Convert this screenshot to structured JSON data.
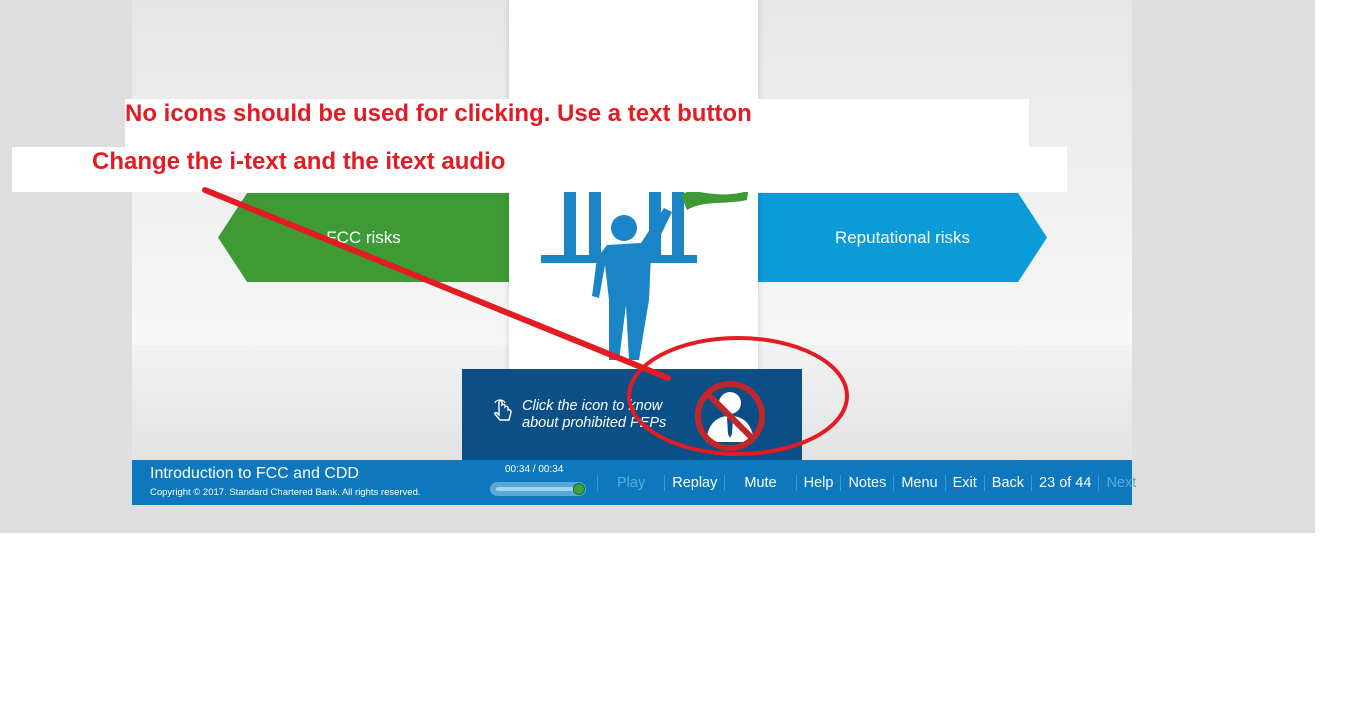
{
  "annotations": {
    "note_1": "No icons should be used for clicking. Use a text button",
    "note_2": "Change the i-text and the itext audio",
    "color": "#e21c22"
  },
  "slide": {
    "left_arrow_label": "FCC risks",
    "right_arrow_label": "Reputational risks",
    "left_arrow_color": "#3e9a35",
    "right_arrow_color": "#0a9bd8",
    "center_icon": "person-waving-flag-bank-icon",
    "info_box": {
      "line_1": "Click the icon to know",
      "line_2": "about prohibited PEPs",
      "hand_icon": "tap-hand-icon",
      "pep_icon": "prohibited-person-icon",
      "color": "#0b4f86"
    }
  },
  "player": {
    "course_title": "Introduction to FCC and CDD",
    "copyright": "Copyright © 2017. Standard Chartered Bank. All rights reserved.",
    "time": "00:34 / 00:34",
    "progress": 1.0,
    "controls": {
      "play": "Play",
      "replay": "Replay",
      "mute": "Mute",
      "help": "Help",
      "notes": "Notes",
      "menu": "Menu",
      "exit": "Exit",
      "back": "Back",
      "page": "23 of 44",
      "next": "Next"
    },
    "bar_color": "#0d78bd"
  }
}
